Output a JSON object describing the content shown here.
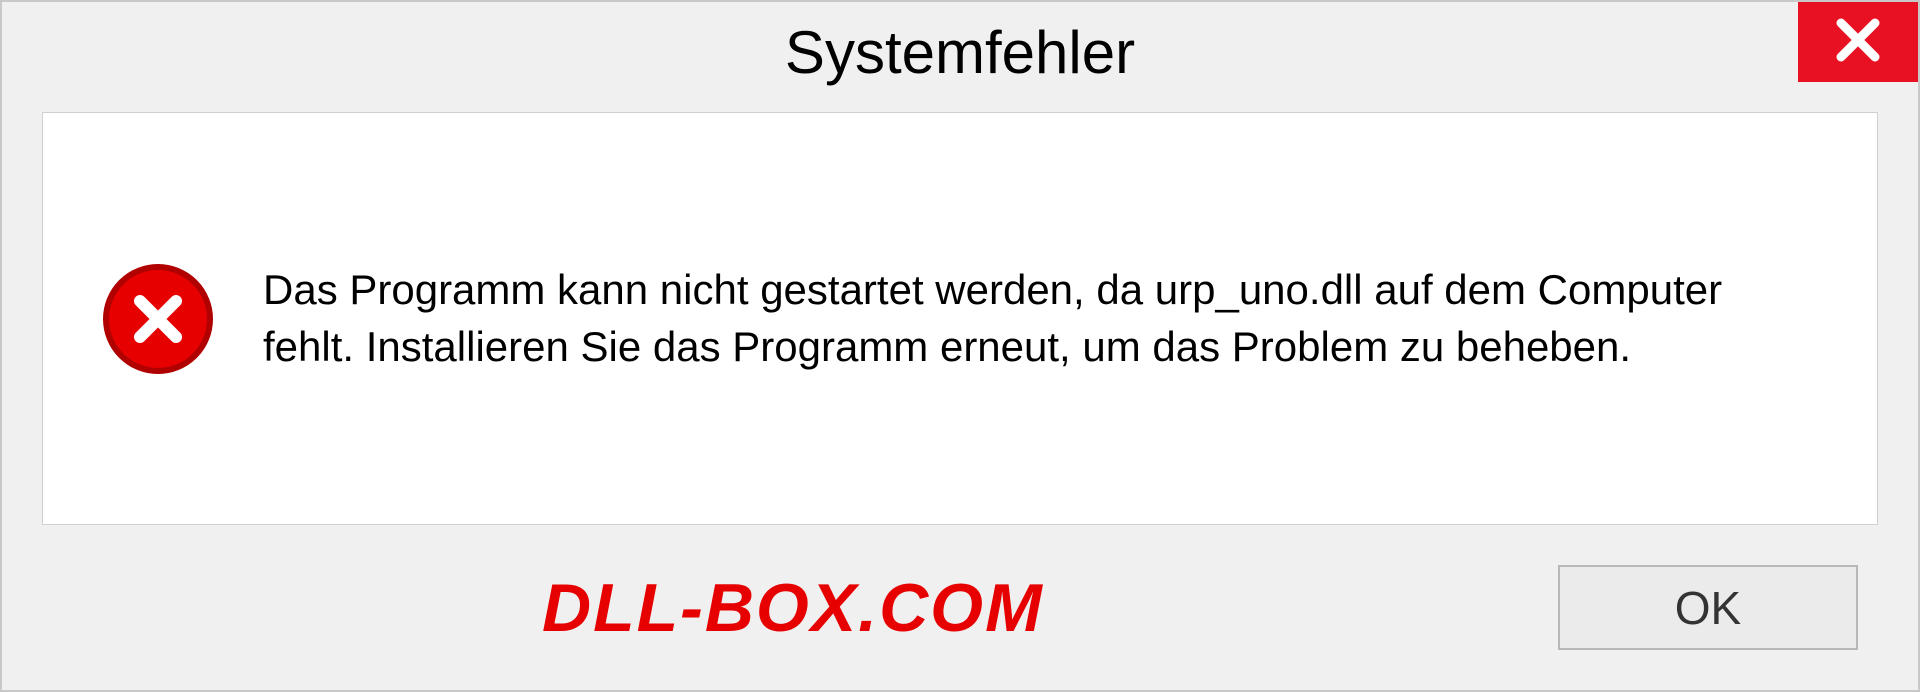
{
  "dialog": {
    "title": "Systemfehler",
    "message": "Das Programm kann nicht gestartet werden, da urp_uno.dll auf dem Computer fehlt. Installieren Sie das Programm erneut, um das Problem zu beheben.",
    "ok_label": "OK"
  },
  "watermark": "DLL-BOX.COM"
}
